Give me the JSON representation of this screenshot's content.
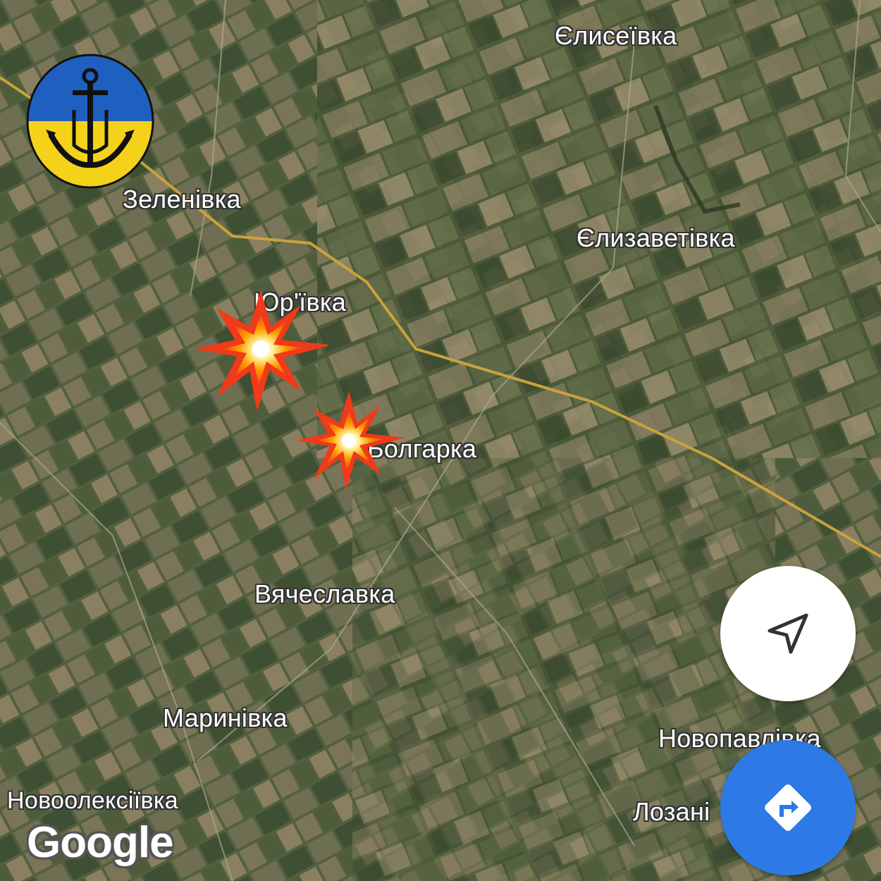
{
  "map": {
    "places": [
      {
        "id": "yelyseivka",
        "name": "Єлисеївка"
      },
      {
        "id": "zelenivka",
        "name": "Зеленівка"
      },
      {
        "id": "yelyzavetivka",
        "name": "Єлизаветівка"
      },
      {
        "id": "yurivka",
        "name": "Юр'ївка"
      },
      {
        "id": "bolharka",
        "name": "Болгарка"
      },
      {
        "id": "viacheslavka",
        "name": "Вячеславка"
      },
      {
        "id": "marynivka",
        "name": "Маринівка"
      },
      {
        "id": "novopavlivka",
        "name": "Новопавлівка"
      },
      {
        "id": "novooleksiivka",
        "name": "Новоолексіївка"
      },
      {
        "id": "lozani",
        "name": "Лозані"
      }
    ],
    "markers": [
      {
        "id": "explosion-1",
        "icon": "explosion-icon",
        "near": "Юр'ївка"
      },
      {
        "id": "explosion-2",
        "icon": "explosion-icon",
        "near": "Болгарка"
      }
    ],
    "attribution": "Google",
    "colors": {
      "road": "#c9a23c",
      "directions_button": "#2d79e6",
      "flag_blue": "#1f5fbf",
      "flag_yellow": "#f5d21a"
    }
  },
  "controls": {
    "locate_icon": "navigation-arrow-icon",
    "directions_icon": "directions-turn-icon"
  },
  "logo": {
    "icon": "anchor-trident-icon"
  }
}
